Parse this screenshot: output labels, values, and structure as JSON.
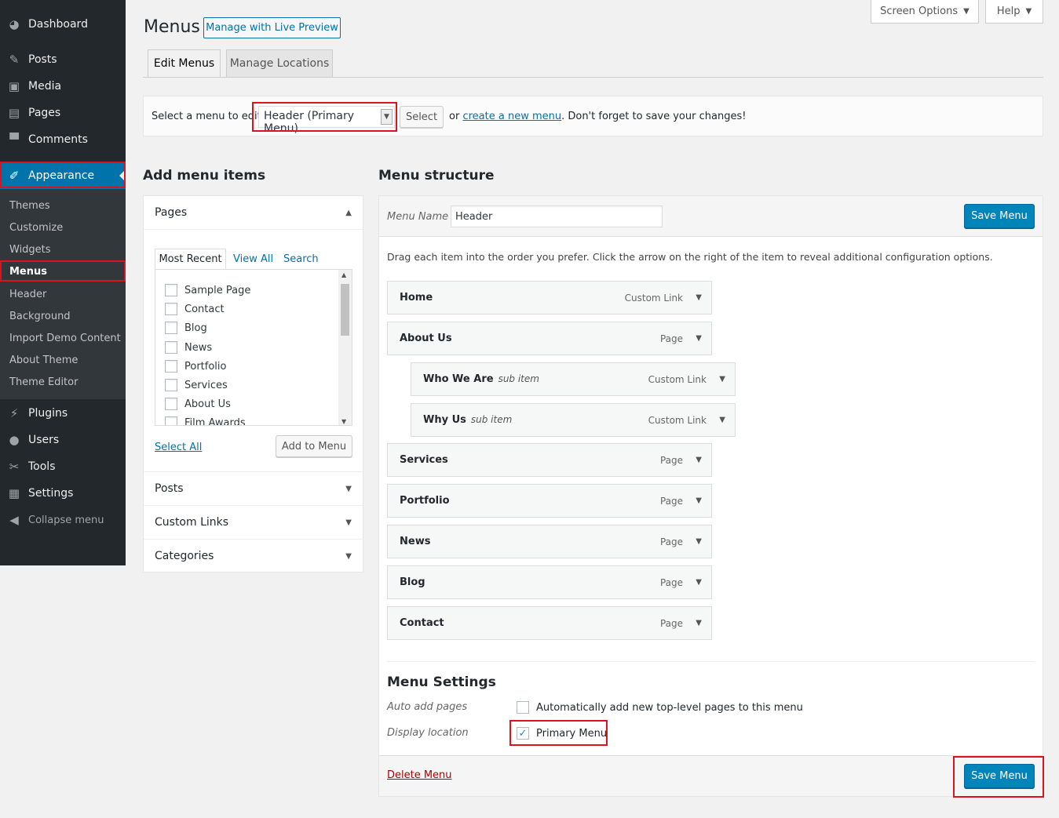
{
  "admin_menu": {
    "items": [
      {
        "label": "Dashboard",
        "icon": "dashboard-icon"
      },
      {
        "label": "Posts",
        "icon": "pin-icon"
      },
      {
        "label": "Media",
        "icon": "media-icon"
      },
      {
        "label": "Pages",
        "icon": "pages-icon"
      },
      {
        "label": "Comments",
        "icon": "comment-icon"
      },
      {
        "label": "Appearance",
        "icon": "brush-icon"
      },
      {
        "label": "Plugins",
        "icon": "plugin-icon"
      },
      {
        "label": "Users",
        "icon": "user-icon"
      },
      {
        "label": "Tools",
        "icon": "wrench-icon"
      },
      {
        "label": "Settings",
        "icon": "settings-icon"
      },
      {
        "label": "Collapse menu",
        "icon": "collapse-icon"
      }
    ],
    "submenu": [
      "Themes",
      "Customize",
      "Widgets",
      "Menus",
      "Header",
      "Background",
      "Import Demo Content",
      "About Theme",
      "Theme Editor"
    ]
  },
  "screen_options": "Screen Options",
  "help": "Help",
  "page_title": "Menus",
  "live_preview": "Manage with Live Preview",
  "nav_tabs": [
    "Edit Menus",
    "Manage Locations"
  ],
  "select_bar": {
    "label": "Select a menu to edit:",
    "selected": "Header (Primary Menu)",
    "select_btn": "Select",
    "or": "or",
    "create_link": "create a new menu",
    "suffix": ". Don't forget to save your changes!"
  },
  "add_items": {
    "title": "Add menu items",
    "pages": {
      "title": "Pages",
      "tabs": [
        "Most Recent",
        "View All",
        "Search"
      ],
      "items": [
        "Sample Page",
        "Contact",
        "Blog",
        "News",
        "Portfolio",
        "Services",
        "About Us",
        "Film Awards"
      ],
      "select_all": "Select All",
      "add_btn": "Add to Menu"
    },
    "sections": [
      "Posts",
      "Custom Links",
      "Categories"
    ]
  },
  "structure": {
    "title": "Menu structure",
    "name_label": "Menu Name",
    "name_value": "Header",
    "save": "Save Menu",
    "instructions": "Drag each item into the order you prefer. Click the arrow on the right of the item to reveal additional configuration options.",
    "items": [
      {
        "title": "Home",
        "sub": "",
        "type": "Custom Link"
      },
      {
        "title": "About Us",
        "sub": "",
        "type": "Page"
      },
      {
        "title": "Who We Are",
        "sub": "sub item",
        "type": "Custom Link"
      },
      {
        "title": "Why Us",
        "sub": "sub item",
        "type": "Custom Link"
      },
      {
        "title": "Services",
        "sub": "",
        "type": "Page"
      },
      {
        "title": "Portfolio",
        "sub": "",
        "type": "Page"
      },
      {
        "title": "News",
        "sub": "",
        "type": "Page"
      },
      {
        "title": "Blog",
        "sub": "",
        "type": "Page"
      },
      {
        "title": "Contact",
        "sub": "",
        "type": "Page"
      }
    ],
    "settings": {
      "title": "Menu Settings",
      "auto_label": "Auto add pages",
      "auto_text": "Automatically add new top-level pages to this menu",
      "loc_label": "Display location",
      "loc_text": "Primary Menu"
    },
    "delete": "Delete Menu"
  }
}
